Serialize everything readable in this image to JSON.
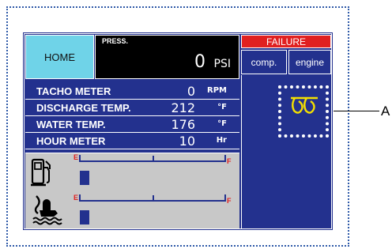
{
  "header": {
    "home_label": "HOME",
    "press_label": "PRESS.",
    "press_value": "0",
    "press_unit": "PSI",
    "failure_label": "FAILURE",
    "tabs": [
      {
        "label": "comp."
      },
      {
        "label": "engine"
      }
    ]
  },
  "readings": [
    {
      "label": "TACHO METER",
      "value": "0",
      "unit": "RPM"
    },
    {
      "label": "DISCHARGE TEMP.",
      "value": "212",
      "unit": "°F"
    },
    {
      "label": "WATER TEMP.",
      "value": "176",
      "unit": "°F"
    },
    {
      "label": "HOUR METER",
      "value": "10",
      "unit": "Hr"
    }
  ],
  "gauges": [
    {
      "icon": "fuel-pump-icon",
      "empty_label": "E",
      "full_label": "F"
    },
    {
      "icon": "coolant-temperature-icon",
      "empty_label": "E",
      "full_label": "F"
    }
  ],
  "failure_indicator": {
    "icon": "glow-plug-icon"
  },
  "callout": {
    "label": "A"
  },
  "colors": {
    "panel_blue": "#23318e",
    "home_cyan": "#6fd3e8",
    "failure_red": "#e02020",
    "gauge_gray": "#c8c8c8"
  }
}
